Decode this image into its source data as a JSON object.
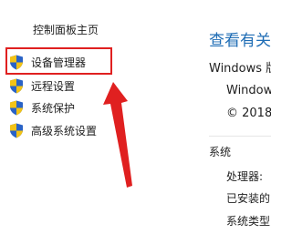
{
  "sidebar": {
    "home_link": "控制面板主页",
    "items": [
      {
        "label": "设备管理器",
        "icon": "shield-icon"
      },
      {
        "label": "远程设置",
        "icon": "shield-icon"
      },
      {
        "label": "系统保护",
        "icon": "shield-icon"
      },
      {
        "label": "高级系统设置",
        "icon": "shield-icon"
      }
    ]
  },
  "main": {
    "title": "查看有关",
    "edition_heading": "Windows 版",
    "os_name": "Window",
    "copyright": "© 2018",
    "system_heading": "系统",
    "rows": [
      "处理器:",
      "已安装的",
      "系统类型"
    ]
  },
  "colors": {
    "highlight": "#e02020",
    "title": "#1f6db5",
    "shield_blue": "#2a63c6",
    "shield_yellow": "#f3c316"
  }
}
